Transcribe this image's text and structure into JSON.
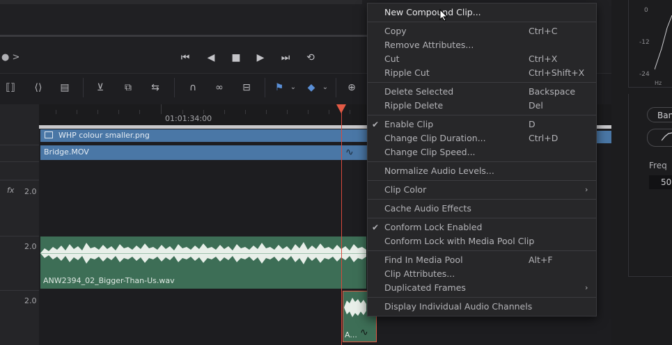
{
  "transport": {
    "icons": [
      "skip-back-icon",
      "step-back-icon",
      "stop-icon",
      "play-icon",
      "skip-forward-icon",
      "loop-icon"
    ],
    "nav_glyph": "● >"
  },
  "timeline": {
    "timecode": "01:01:34:00",
    "video_track_clips": [
      {
        "name": "WHP colour smaller.png"
      },
      {
        "name": "Bridge.MOV"
      }
    ],
    "audio_tracks": [
      {
        "label": "2.0"
      },
      {
        "label": "2.0",
        "clip_name": "ANW2394_02_Bigger-Than-Us.wav"
      },
      {
        "label": "2.0",
        "clip_name": "A..."
      }
    ],
    "fx_label": "fx"
  },
  "context_menu": {
    "items": [
      {
        "label": "New Compound Clip...",
        "shortcut": "",
        "checked": false,
        "submenu": false
      },
      {
        "label": "Copy",
        "shortcut": "Ctrl+C",
        "checked": false,
        "submenu": false
      },
      {
        "label": "Remove Attributes...",
        "shortcut": "",
        "checked": false,
        "submenu": false
      },
      {
        "label": "Cut",
        "shortcut": "Ctrl+X",
        "checked": false,
        "submenu": false
      },
      {
        "label": "Ripple Cut",
        "shortcut": "Ctrl+Shift+X",
        "checked": false,
        "submenu": false
      },
      {
        "label": "Delete Selected",
        "shortcut": "Backspace",
        "checked": false,
        "submenu": false
      },
      {
        "label": "Ripple Delete",
        "shortcut": "Del",
        "checked": false,
        "submenu": false
      },
      {
        "label": "Enable Clip",
        "shortcut": "D",
        "checked": true,
        "submenu": false
      },
      {
        "label": "Change Clip Duration...",
        "shortcut": "Ctrl+D",
        "checked": false,
        "submenu": false
      },
      {
        "label": "Change Clip Speed...",
        "shortcut": "",
        "checked": false,
        "submenu": false
      },
      {
        "label": "Normalize Audio Levels...",
        "shortcut": "",
        "checked": false,
        "submenu": false
      },
      {
        "label": "Clip Color",
        "shortcut": "",
        "checked": false,
        "submenu": true
      },
      {
        "label": "Cache Audio Effects",
        "shortcut": "",
        "checked": false,
        "submenu": false
      },
      {
        "label": "Conform Lock Enabled",
        "shortcut": "",
        "checked": true,
        "submenu": false
      },
      {
        "label": "Conform Lock with Media Pool Clip",
        "shortcut": "",
        "checked": false,
        "submenu": false
      },
      {
        "label": "Find In Media Pool",
        "shortcut": "Alt+F",
        "checked": false,
        "submenu": false
      },
      {
        "label": "Clip Attributes...",
        "shortcut": "",
        "checked": false,
        "submenu": false
      },
      {
        "label": "Duplicated Frames",
        "shortcut": "",
        "checked": false,
        "submenu": true
      },
      {
        "label": "Display Individual Audio Channels",
        "shortcut": "",
        "checked": false,
        "submenu": false
      }
    ]
  },
  "right_panel": {
    "eq_labels": [
      "0",
      "-12",
      "-24"
    ],
    "hz_label": "Hz",
    "band_button": "Ban",
    "freq_label": "Freq",
    "freq_value": "50"
  },
  "colors": {
    "accent_red": "#e35a45",
    "video_clip": "#4a77a6",
    "audio_clip": "#3d6e56"
  }
}
